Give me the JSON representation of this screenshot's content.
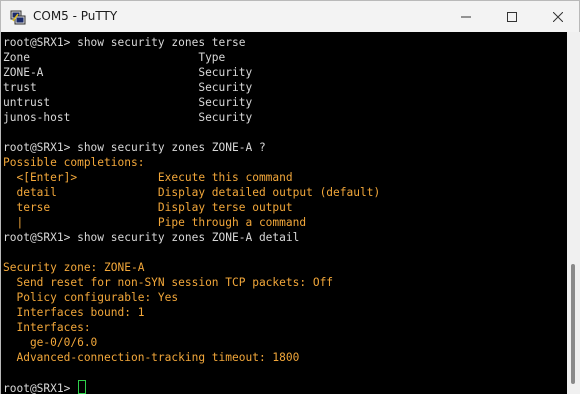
{
  "window": {
    "title": "COM5 - PuTTY",
    "icon": "putty-icon",
    "controls": [
      "minimize-icon",
      "maximize-icon",
      "close-icon"
    ]
  },
  "colors": {
    "terminal_bg": "#000000",
    "default_text": "#d8d8d8",
    "junos_output": "#f2a73a",
    "cursor": "#2fd14b"
  },
  "terminal": {
    "lines": [
      "root@SRX1> show security zones terse",
      "Zone                         Type",
      "ZONE-A                       Security",
      "trust                        Security",
      "untrust                      Security",
      "junos-host                   Security",
      "",
      "root@SRX1> show security zones ZONE-A ?",
      "Possible completions:",
      "  <[Enter]>            Execute this command",
      "  detail               Display detailed output (default)",
      "  terse                Display terse output",
      "  |                    Pipe through a command",
      "root@SRX1> show security zones ZONE-A detail",
      "",
      "Security zone: ZONE-A",
      "  Send reset for non-SYN session TCP packets: Off",
      "  Policy configurable: Yes",
      "  Interfaces bound: 1",
      "  Interfaces:",
      "    ge-0/0/6.0",
      "  Advanced-connection-tracking timeout: 1800",
      "",
      "root@SRX1> "
    ]
  }
}
